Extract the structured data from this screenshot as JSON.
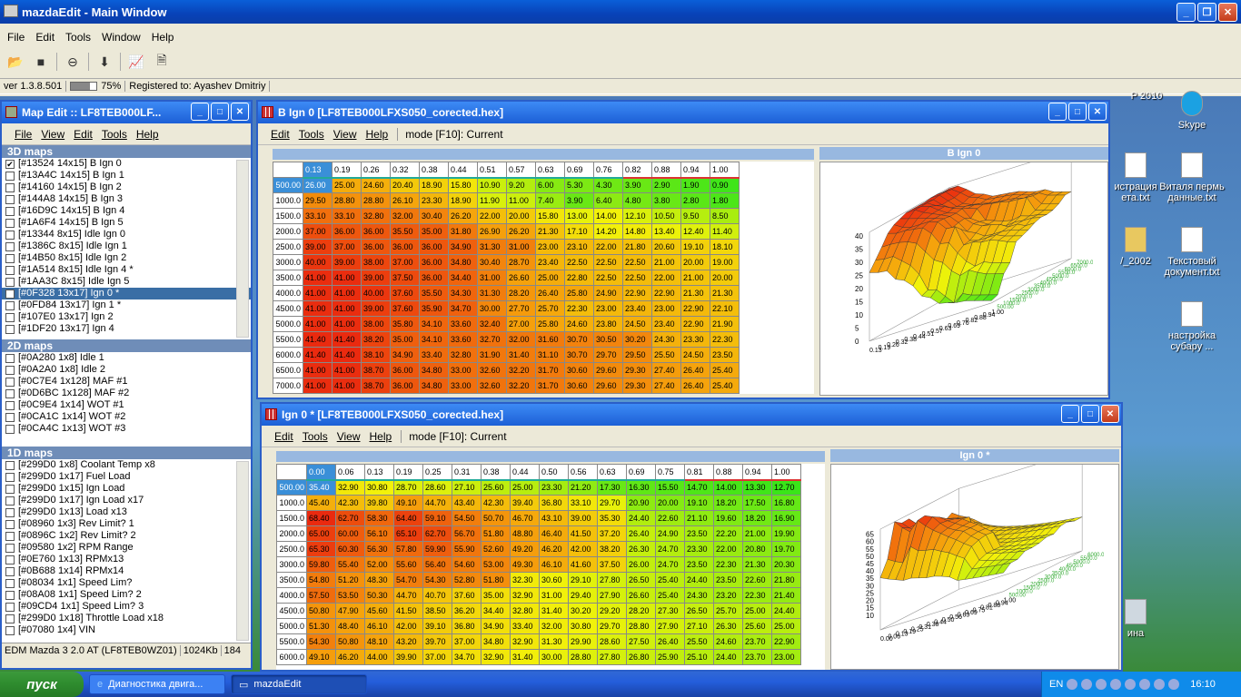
{
  "app": {
    "title": "mazdaEdit - Main Window"
  },
  "menu": [
    "File",
    "Edit",
    "Tools",
    "Window",
    "Help"
  ],
  "status": {
    "version": "ver 1.3.8.501",
    "progress": "75%",
    "progress_value": 0.75,
    "registered": "Registered to: Ayashev Dmitriy"
  },
  "maplist": {
    "title": "Map Edit :: LF8TEB000LF...",
    "menu": [
      "File",
      "View",
      "Edit",
      "Tools",
      "Help"
    ],
    "sec3d": "3D maps",
    "items3d": [
      {
        "t": "[#13524 14x15] B Ign 0",
        "c": true
      },
      {
        "t": "[#13A4C 14x15] B Ign 1",
        "c": false
      },
      {
        "t": "[#14160 14x15] B Ign 2",
        "c": false
      },
      {
        "t": "[#144A8 14x15] B Ign 3",
        "c": false
      },
      {
        "t": "[#16D9C 14x15] B Ign 4",
        "c": false
      },
      {
        "t": "[#1A6F4 14x15] B Ign 5",
        "c": false
      },
      {
        "t": "[#13344 8x15] Idle Ign 0",
        "c": false
      },
      {
        "t": "[#1386C 8x15] Idle Ign 1",
        "c": false
      },
      {
        "t": "[#14B50 8x15] Idle Ign 2",
        "c": false
      },
      {
        "t": "[#1A514 8x15] Idle Ign 4 *",
        "c": false
      },
      {
        "t": "[#1AA3C 8x15] Idle Ign 5",
        "c": false
      },
      {
        "t": "[#0F328 13x17] Ign 0 *",
        "c": true,
        "sel": true
      },
      {
        "t": "[#0FD84 13x17] Ign 1 *",
        "c": false
      },
      {
        "t": "[#107E0 13x17] Ign 2",
        "c": false
      },
      {
        "t": "[#1DF20 13x17] Ign 4",
        "c": false
      }
    ],
    "sec2d": "2D maps",
    "items2d": [
      "[#0A280 1x8] Idle 1",
      "[#0A2A0 1x8] Idle 2",
      "[#0C7E4 1x128] MAF #1",
      "[#0D6BC 1x128] MAF #2",
      "[#0C9E4 1x14] WOT #1",
      "[#0CA1C 1x14] WOT #2",
      "[#0CA4C 1x13] WOT #3"
    ],
    "sec1d": "1D maps",
    "items1d": [
      "[#299D0 1x8] Coolant Temp x8",
      "[#299D0 1x17] Fuel Load",
      "[#299D0 1x15] Ign Load",
      "[#299D0 1x17] Ign Load x17",
      "[#299D0 1x13] Load x13",
      "[#08960 1x3] Rev Limit? 1",
      "[#0896C 1x2] Rev Limit? 2",
      "[#09580 1x2] RPM Range",
      "[#0E760 1x13] RPMx13",
      "[#0B688 1x14] RPMx14",
      "[#08034 1x1] Speed Lim?",
      "[#08A08 1x1] Speed Lim? 2",
      "[#09CD4 1x1] Speed Lim? 3",
      "[#299D0 1x18] Throttle Load x18",
      "[#07080 1x4] VIN"
    ],
    "footer": [
      "EDM Mazda 3 2.0 AT (LF8TEB0WZ01)",
      "1024Kb",
      "184"
    ]
  },
  "win1": {
    "title": "B Ign 0 [LF8TEB000LFXS050_corected.hex]",
    "menu": [
      "Edit",
      "Tools",
      "View",
      "Help"
    ],
    "mode": "mode [F10]: Current",
    "plot_title": "B Ign 0",
    "cols": [
      "0.13",
      "0.19",
      "0.26",
      "0.32",
      "0.38",
      "0.44",
      "0.51",
      "0.57",
      "0.63",
      "0.69",
      "0.76",
      "0.82",
      "0.88",
      "0.94",
      "1.00"
    ],
    "rows": [
      "500.00",
      "1000.0",
      "1500.0",
      "2000.0",
      "2500.0",
      "3000.0",
      "3500.0",
      "4000.0",
      "4500.0",
      "5000.0",
      "5500.0",
      "6000.0",
      "6500.0",
      "7000.0"
    ],
    "cells": [
      [
        "26.00",
        "25.00",
        "24.60",
        "20.40",
        "18.90",
        "15.80",
        "10.90",
        "9.20",
        "6.00",
        "5.30",
        "4.30",
        "3.90",
        "2.90",
        "1.90",
        "0.90"
      ],
      [
        "29.50",
        "28.80",
        "28.80",
        "26.10",
        "23.30",
        "18.90",
        "11.90",
        "11.00",
        "7.40",
        "3.90",
        "6.40",
        "4.80",
        "3.80",
        "2.80",
        "1.80"
      ],
      [
        "33.10",
        "33.10",
        "32.80",
        "32.00",
        "30.40",
        "26.20",
        "22.00",
        "20.00",
        "15.80",
        "13.00",
        "14.00",
        "12.10",
        "10.50",
        "9.50",
        "8.50"
      ],
      [
        "37.00",
        "36.00",
        "36.00",
        "35.50",
        "35.00",
        "31.80",
        "26.90",
        "26.20",
        "21.30",
        "17.10",
        "14.20",
        "14.80",
        "13.40",
        "12.40",
        "11.40"
      ],
      [
        "39.00",
        "37.00",
        "36.00",
        "36.00",
        "36.00",
        "34.90",
        "31.30",
        "31.00",
        "23.00",
        "23.10",
        "22.00",
        "21.80",
        "20.60",
        "19.10",
        "18.10"
      ],
      [
        "40.00",
        "39.00",
        "38.00",
        "37.00",
        "36.00",
        "34.80",
        "30.40",
        "28.70",
        "23.40",
        "22.50",
        "22.50",
        "22.50",
        "21.00",
        "20.00",
        "19.00"
      ],
      [
        "41.00",
        "41.00",
        "39.00",
        "37.50",
        "36.00",
        "34.40",
        "31.00",
        "26.60",
        "25.00",
        "22.80",
        "22.50",
        "22.50",
        "22.00",
        "21.00",
        "20.00"
      ],
      [
        "41.00",
        "41.00",
        "40.00",
        "37.60",
        "35.50",
        "34.30",
        "31.30",
        "28.20",
        "26.40",
        "25.80",
        "24.90",
        "22.90",
        "22.90",
        "21.30",
        "21.30"
      ],
      [
        "41.00",
        "41.00",
        "39.00",
        "37.60",
        "35.90",
        "34.70",
        "30.00",
        "27.70",
        "25.70",
        "22.30",
        "23.00",
        "23.40",
        "23.00",
        "22.90",
        "22.10"
      ],
      [
        "41.00",
        "41.00",
        "38.00",
        "35.80",
        "34.10",
        "33.60",
        "32.40",
        "27.00",
        "25.80",
        "24.60",
        "23.80",
        "24.50",
        "23.40",
        "22.90",
        "21.90"
      ],
      [
        "41.40",
        "41.40",
        "38.20",
        "35.00",
        "34.10",
        "33.60",
        "32.70",
        "32.00",
        "31.60",
        "30.70",
        "30.50",
        "30.20",
        "24.30",
        "23.30",
        "22.30"
      ],
      [
        "41.40",
        "41.40",
        "38.10",
        "34.90",
        "33.40",
        "32.80",
        "31.90",
        "31.40",
        "31.10",
        "30.70",
        "29.70",
        "29.50",
        "25.50",
        "24.50",
        "23.50"
      ],
      [
        "41.00",
        "41.00",
        "38.70",
        "36.00",
        "34.80",
        "33.00",
        "32.60",
        "32.20",
        "31.70",
        "30.60",
        "29.60",
        "29.30",
        "27.40",
        "26.40",
        "25.40"
      ],
      [
        "41.00",
        "41.00",
        "38.70",
        "36.00",
        "34.80",
        "33.00",
        "32.60",
        "32.20",
        "31.70",
        "30.60",
        "29.60",
        "29.30",
        "27.40",
        "26.40",
        "25.40"
      ]
    ],
    "zaxis": [
      "40",
      "35",
      "30",
      "25",
      "20",
      "15",
      "10",
      "5",
      "0"
    ]
  },
  "win2": {
    "title": "Ign 0 * [LF8TEB000LFXS050_corected.hex]",
    "menu": [
      "Edit",
      "Tools",
      "View",
      "Help"
    ],
    "mode": "mode [F10]: Current",
    "plot_title": "Ign 0 *",
    "cols": [
      "0.00",
      "0.06",
      "0.13",
      "0.19",
      "0.25",
      "0.31",
      "0.38",
      "0.44",
      "0.50",
      "0.56",
      "0.63",
      "0.69",
      "0.75",
      "0.81",
      "0.88",
      "0.94",
      "1.00"
    ],
    "rows": [
      "500.00",
      "1000.0",
      "1500.0",
      "2000.0",
      "2500.0",
      "3000.0",
      "3500.0",
      "4000.0",
      "4500.0",
      "5000.0",
      "5500.0",
      "6000.0"
    ],
    "cells": [
      [
        "35.40",
        "32.90",
        "30.80",
        "28.70",
        "28.60",
        "27.10",
        "25.60",
        "25.00",
        "23.30",
        "21.20",
        "17.30",
        "16.30",
        "15.50",
        "14.70",
        "14.00",
        "13.30",
        "12.70"
      ],
      [
        "45.40",
        "42.30",
        "39.80",
        "49.10",
        "44.70",
        "43.40",
        "42.30",
        "39.40",
        "36.80",
        "33.10",
        "29.70",
        "20.90",
        "20.00",
        "19.10",
        "18.20",
        "17.50",
        "16.80"
      ],
      [
        "68.40",
        "62.70",
        "58.30",
        "64.40",
        "59.10",
        "54.50",
        "50.70",
        "46.70",
        "43.10",
        "39.00",
        "35.30",
        "24.40",
        "22.60",
        "21.10",
        "19.60",
        "18.20",
        "16.90"
      ],
      [
        "65.00",
        "60.00",
        "56.10",
        "65.10",
        "62.70",
        "56.70",
        "51.80",
        "48.80",
        "46.40",
        "41.50",
        "37.20",
        "26.40",
        "24.90",
        "23.50",
        "22.20",
        "21.00",
        "19.90"
      ],
      [
        "65.30",
        "60.30",
        "56.30",
        "57.80",
        "59.90",
        "55.90",
        "52.60",
        "49.20",
        "46.20",
        "42.00",
        "38.20",
        "26.30",
        "24.70",
        "23.30",
        "22.00",
        "20.80",
        "19.70"
      ],
      [
        "59.80",
        "55.40",
        "52.00",
        "55.60",
        "56.40",
        "54.60",
        "53.00",
        "49.30",
        "46.10",
        "41.60",
        "37.50",
        "26.00",
        "24.70",
        "23.50",
        "22.30",
        "21.30",
        "20.30"
      ],
      [
        "54.80",
        "51.20",
        "48.30",
        "54.70",
        "54.30",
        "52.80",
        "51.80",
        "32.30",
        "30.60",
        "29.10",
        "27.80",
        "26.50",
        "25.40",
        "24.40",
        "23.50",
        "22.60",
        "21.80"
      ],
      [
        "57.50",
        "53.50",
        "50.30",
        "44.70",
        "40.70",
        "37.60",
        "35.00",
        "32.90",
        "31.00",
        "29.40",
        "27.90",
        "26.60",
        "25.40",
        "24.30",
        "23.20",
        "22.30",
        "21.40"
      ],
      [
        "50.80",
        "47.90",
        "45.60",
        "41.50",
        "38.50",
        "36.20",
        "34.40",
        "32.80",
        "31.40",
        "30.20",
        "29.20",
        "28.20",
        "27.30",
        "26.50",
        "25.70",
        "25.00",
        "24.40"
      ],
      [
        "51.30",
        "48.40",
        "46.10",
        "42.00",
        "39.10",
        "36.80",
        "34.90",
        "33.40",
        "32.00",
        "30.80",
        "29.70",
        "28.80",
        "27.90",
        "27.10",
        "26.30",
        "25.60",
        "25.00"
      ],
      [
        "54.30",
        "50.80",
        "48.10",
        "43.20",
        "39.70",
        "37.00",
        "34.80",
        "32.90",
        "31.30",
        "29.90",
        "28.60",
        "27.50",
        "26.40",
        "25.50",
        "24.60",
        "23.70",
        "22.90"
      ],
      [
        "49.10",
        "46.20",
        "44.00",
        "39.90",
        "37.00",
        "34.70",
        "32.90",
        "31.40",
        "30.00",
        "28.80",
        "27.80",
        "26.80",
        "25.90",
        "25.10",
        "24.40",
        "23.70",
        "23.00"
      ]
    ],
    "zaxis": [
      "65",
      "60",
      "55",
      "50",
      "45",
      "40",
      "35",
      "30",
      "25",
      "20",
      "15",
      "10"
    ]
  },
  "desktop": [
    {
      "label": "P 2010"
    },
    {
      "label": "Skype"
    },
    {
      "label": "истрация ета.txt"
    },
    {
      "label": "Виталя пермь данные.txt"
    },
    {
      "label": "/_2002"
    },
    {
      "label": "Текстовый документ.txt"
    },
    {
      "label": "настройка субару ..."
    },
    {
      "label": "ина"
    }
  ],
  "taskbar": {
    "start": "пуск",
    "buttons": [
      "Диагностика двига...",
      "mazdaEdit"
    ],
    "lang": "EN",
    "time": "16:10"
  },
  "colors": {
    "xp_blue": "#0a5fd8",
    "green": "#33e41a",
    "yellow": "#f2f20a",
    "orange": "#f59c0c",
    "red": "#ea2a0f"
  }
}
